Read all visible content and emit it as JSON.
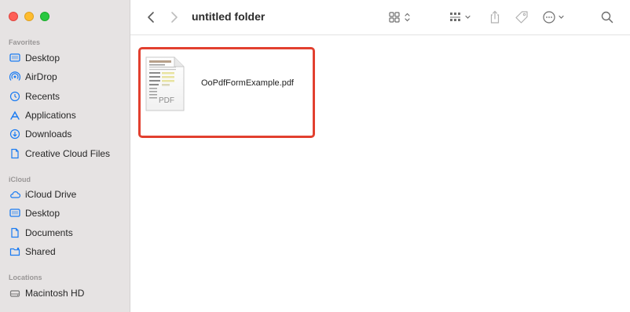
{
  "window": {
    "title": "untitled folder"
  },
  "sidebar": {
    "sections": [
      {
        "title": "Favorites",
        "items": [
          {
            "label": "Desktop",
            "icon": "desktop-icon"
          },
          {
            "label": "AirDrop",
            "icon": "airdrop-icon"
          },
          {
            "label": "Recents",
            "icon": "clock-icon"
          },
          {
            "label": "Applications",
            "icon": "applications-icon"
          },
          {
            "label": "Downloads",
            "icon": "download-icon"
          },
          {
            "label": "Creative Cloud Files",
            "icon": "document-icon"
          }
        ]
      },
      {
        "title": "iCloud",
        "items": [
          {
            "label": "iCloud Drive",
            "icon": "cloud-icon"
          },
          {
            "label": "Desktop",
            "icon": "desktop-icon"
          },
          {
            "label": "Documents",
            "icon": "document-icon"
          },
          {
            "label": "Shared",
            "icon": "shared-folder-icon"
          }
        ]
      },
      {
        "title": "Locations",
        "items": [
          {
            "label": "Macintosh HD",
            "icon": "disk-icon"
          }
        ]
      }
    ]
  },
  "files": [
    {
      "name": "OoPdfFormExample.pdf",
      "icon_label": "PDF",
      "selected_highlight": true
    }
  ],
  "colors": {
    "accent": "#1a7bf2",
    "highlight": "#e2402f",
    "sidebar_bg": "#e6e3e3"
  }
}
